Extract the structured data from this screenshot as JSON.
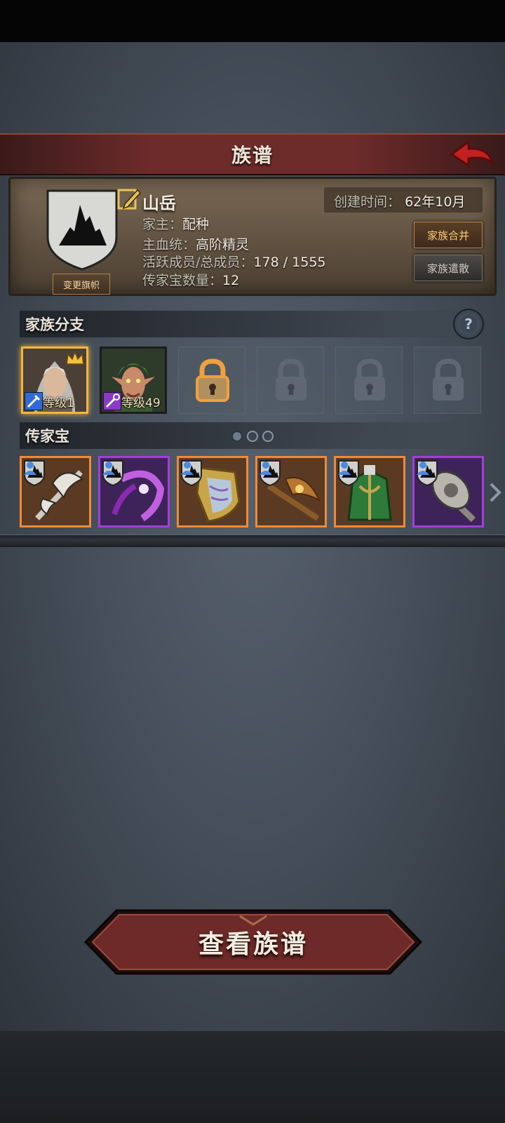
{
  "header": {
    "title": "族谱"
  },
  "family": {
    "name": "山岳",
    "created_label": "创建时间：",
    "created_value": "62年10月",
    "leader_label": "家主：",
    "leader_value": "配种",
    "bloodline_label": "主血统：",
    "bloodline_value": "高阶精灵",
    "members_label": "活跃成员/总成员：",
    "members_value": "178 / 1555",
    "heirloom_count_label": "传家宝数量：",
    "heirloom_count_value": "12",
    "change_banner_label": "变更旗帜"
  },
  "actions": {
    "merge_label": "家族合并",
    "disband_label": "家族遣散"
  },
  "branches": {
    "title": "家族分支",
    "items": [
      {
        "level": "等级1",
        "selected": true,
        "crown": true,
        "class_icon": "sword-icon"
      },
      {
        "level": "等级49",
        "selected": false,
        "crown": false,
        "class_icon": "staff-icon"
      }
    ],
    "unlockable_slots": 1,
    "locked_slots": 3
  },
  "heirlooms": {
    "title": "传家宝",
    "page_indicator": {
      "pages": 3
    },
    "items": [
      {
        "name": "axe-icon",
        "rarity": "orange"
      },
      {
        "name": "scythe-icon",
        "rarity": "purple"
      },
      {
        "name": "shield-icon",
        "rarity": "orange"
      },
      {
        "name": "staff-icon",
        "rarity": "orange"
      },
      {
        "name": "armor-icon",
        "rarity": "orange"
      },
      {
        "name": "hammer-icon",
        "rarity": "purple"
      }
    ]
  },
  "footer": {
    "view_tree_label": "查看族谱"
  },
  "colors": {
    "orange_rarity": "#f08a38",
    "purple_rarity": "#a040d8",
    "selected_gold": "#f2b53c",
    "title_red": "#6d2b2a"
  }
}
